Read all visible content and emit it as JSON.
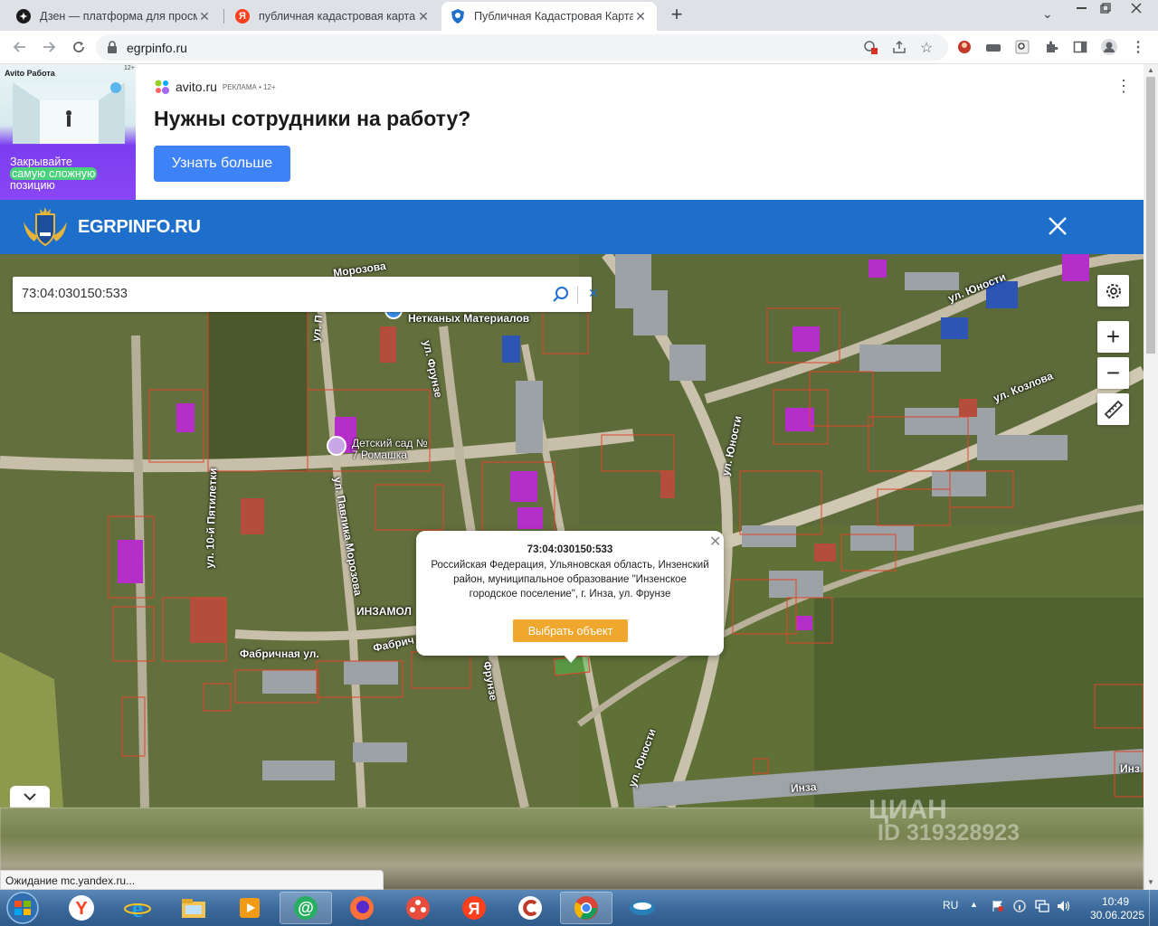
{
  "browser": {
    "tabs": [
      {
        "title": "Дзен — платформа для просмотра",
        "favicon": "dzen-icon",
        "active": false
      },
      {
        "title": "публичная кадастровая карта — Яндекс",
        "favicon": "yandex-icon",
        "active": false
      },
      {
        "title": "Публичная Кадастровая Карта Росреестра",
        "favicon": "egrp-shield-icon",
        "active": true
      }
    ],
    "new_tab_label": "+",
    "url": "egrpinfo.ru"
  },
  "ad": {
    "image_brand": "Avito Работа",
    "image_age": "12+",
    "image_text_line1": "Закрывайте",
    "image_text_line2": "самую сложную",
    "image_text_line3": "позицию",
    "site": "avito.ru",
    "mark": "РЕКЛАМА • 12+",
    "title": "Нужны сотрудники на работу?",
    "button": "Узнать больше"
  },
  "site": {
    "name": "EGRPINFO.RU",
    "brand_color": "#1e6fcb"
  },
  "map": {
    "search_value": "73:04:030150:533",
    "labels": {
      "morozova": "Морозова",
      "netkanyh": "Нетканых Материалов",
      "frunze": "ул. Фрунзе",
      "yunosti_top": "ул. Юности",
      "kozlova": "ул. Козлова",
      "yunosti_mid": "ул. Юности",
      "detsad": "Детский сад №",
      "detsad2": "7 Ромашка",
      "pyatiletki": "ул. 10-й Пятилетки",
      "pavlika": "ул. Павлика Морозова",
      "inzamol": "ИНЗАМОЛ",
      "fabrichnaya": "Фабричная ул.",
      "fabrichnaya2": "Фабрич",
      "frunze2": "Фрунзе",
      "yunosti_low": "ул. Юности",
      "inza": "Инза",
      "inza2": "Инз",
      "pavl_top": "ул. П"
    },
    "popup": {
      "cadastral_number": "73:04:030150:533",
      "address": "Российская Федерация, Ульяновская область, Инзенский район, муниципальное образование \"Инзенское городское поселение\", г. Инза, ул. Фрунзе",
      "button": "Выбрать объект",
      "button_color": "#efa72e"
    },
    "controls": {
      "zoom_in": "+",
      "zoom_out": "−"
    }
  },
  "watermark": {
    "line1": "ЦИАН",
    "line2": "ID 319328923"
  },
  "status": "Ожидание mc.yandex.ru...",
  "taskbar": {
    "lang": "RU",
    "time": "10:49",
    "date": "30.06.2025"
  }
}
